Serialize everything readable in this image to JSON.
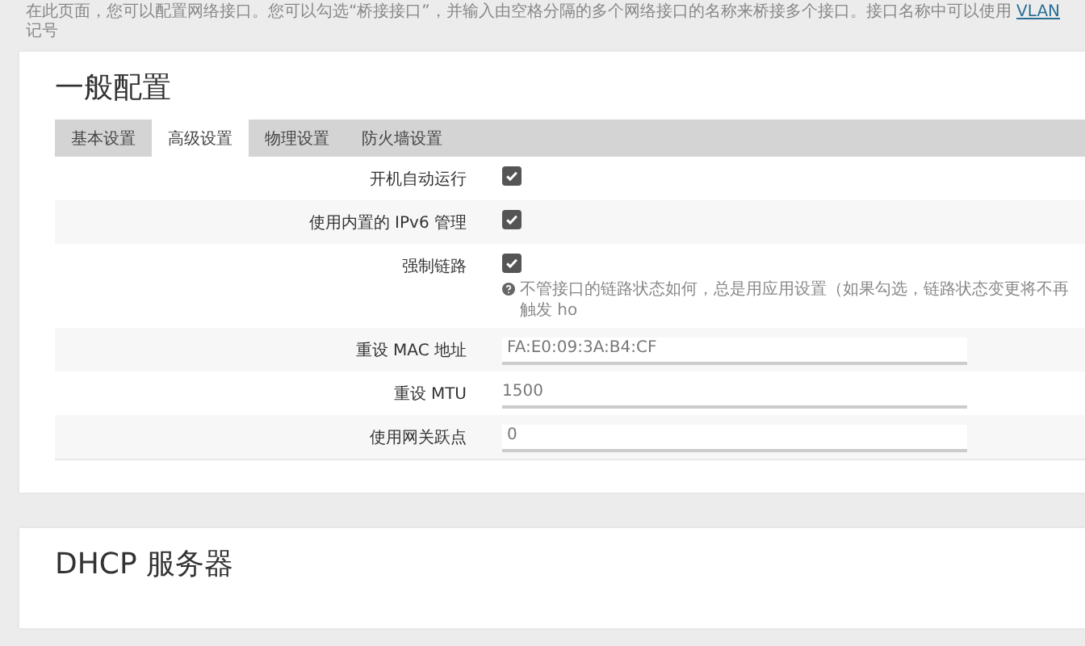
{
  "intro": {
    "text": "在此页面，您可以配置网络接口。您可以勾选“桥接接口”，并输入由空格分隔的多个网络接口的名称来桥接多个接口。接口名称中可以使用",
    "link": "VLAN",
    "after": "记号"
  },
  "sections": [
    {
      "title": "一般配置",
      "tabs": [
        {
          "label": "基本设置",
          "selected": false
        },
        {
          "label": "高级设置",
          "selected": true
        },
        {
          "label": "物理设置",
          "selected": false
        },
        {
          "label": "防火墙设置",
          "selected": false
        }
      ],
      "fields": [
        {
          "kind": "checkbox",
          "label": "开机自动运行",
          "checked": true
        },
        {
          "kind": "checkbox",
          "label": "使用内置的 IPv6 管理",
          "checked": true
        },
        {
          "kind": "checkbox",
          "label": "强制链路",
          "checked": true,
          "hint": "不管接口的链路状态如何，总是用应用设置（如果勾选，链路状态变更将不再触发 ho"
        },
        {
          "kind": "text",
          "label": "重设 MAC 地址",
          "placeholder": "FA:E0:09:3A:B4:CF"
        },
        {
          "kind": "text",
          "label": "重设 MTU",
          "placeholder": "1500"
        },
        {
          "kind": "text",
          "label": "使用网关跃点",
          "placeholder": "0"
        }
      ]
    },
    {
      "title": "DHCP 服务器"
    }
  ]
}
